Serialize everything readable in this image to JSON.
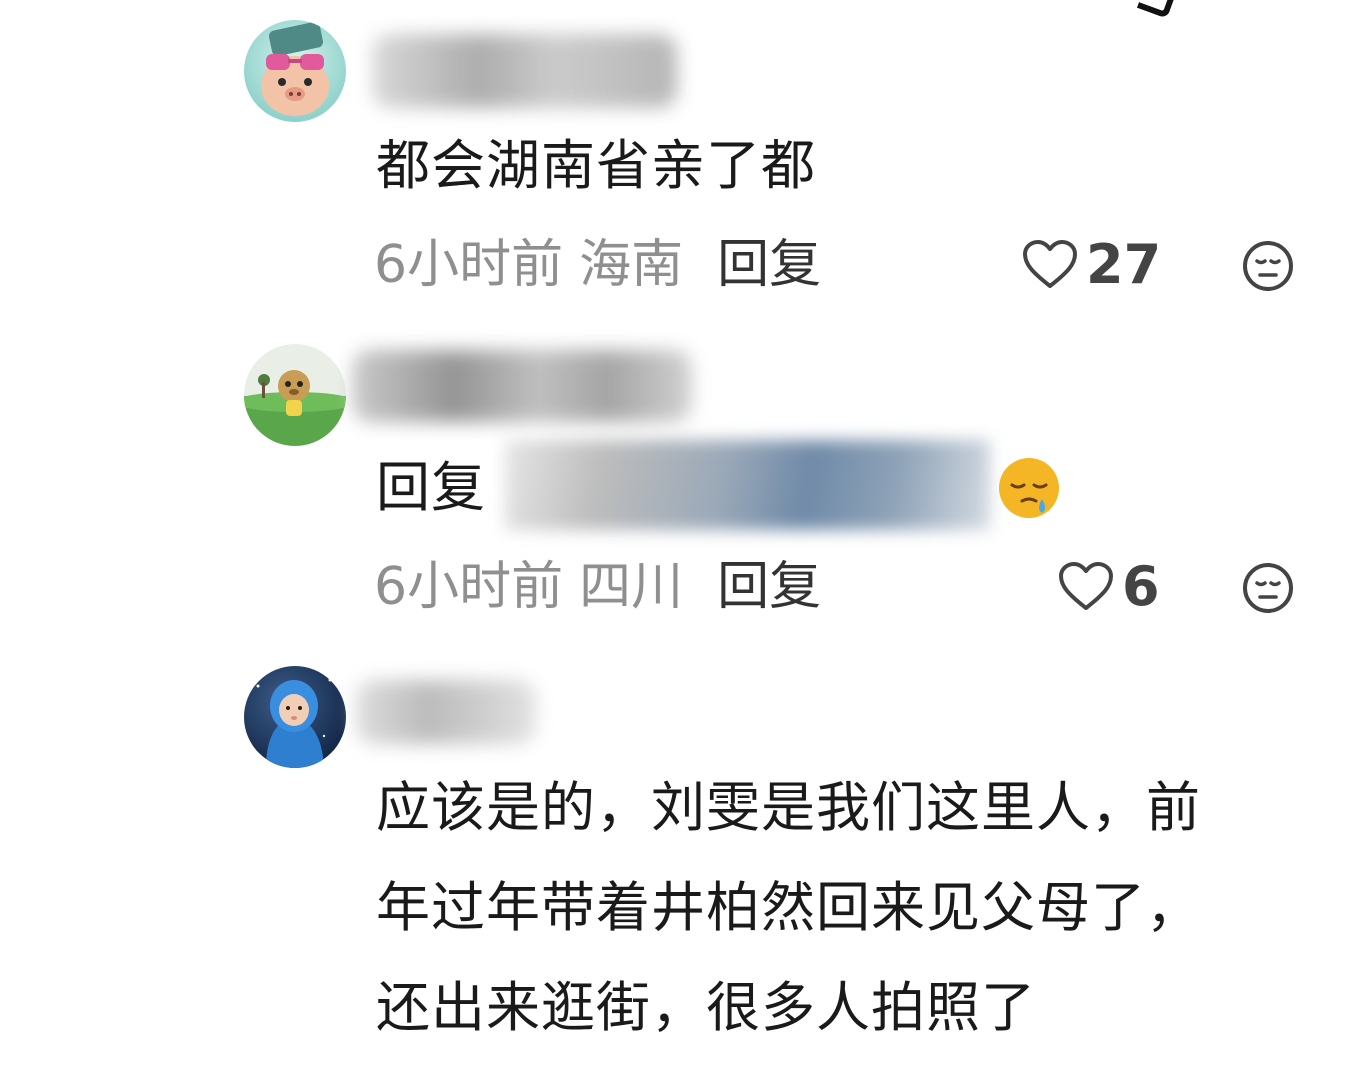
{
  "comments": [
    {
      "text_lines": [
        "都会湖南省亲了都"
      ],
      "time": "6小时前",
      "location": "海南",
      "reply_label": "回复",
      "likes": "27",
      "avatar_icon": "pig-with-sunglasses-avatar"
    },
    {
      "reply_prefix": "回复",
      "time": "6小时前",
      "location": "四川",
      "reply_label": "回复",
      "likes": "6",
      "avatar_icon": "cartoon-on-grass-avatar",
      "emoji_icon": "sleepy-face-emoji"
    },
    {
      "text_lines": [
        "应该是的，刘雯是我们这里人，前",
        "年过年带着井柏然回来见父母了，",
        "还出来逛街，很多人拍照了"
      ],
      "avatar_icon": "child-in-blue-hood-avatar"
    }
  ],
  "colors": {
    "meta_gray": "#8f8f8f",
    "text": "#1a1a1a",
    "like_gray": "#444444"
  },
  "icons": [
    "heart-outline-icon",
    "unhappy-face-icon"
  ]
}
